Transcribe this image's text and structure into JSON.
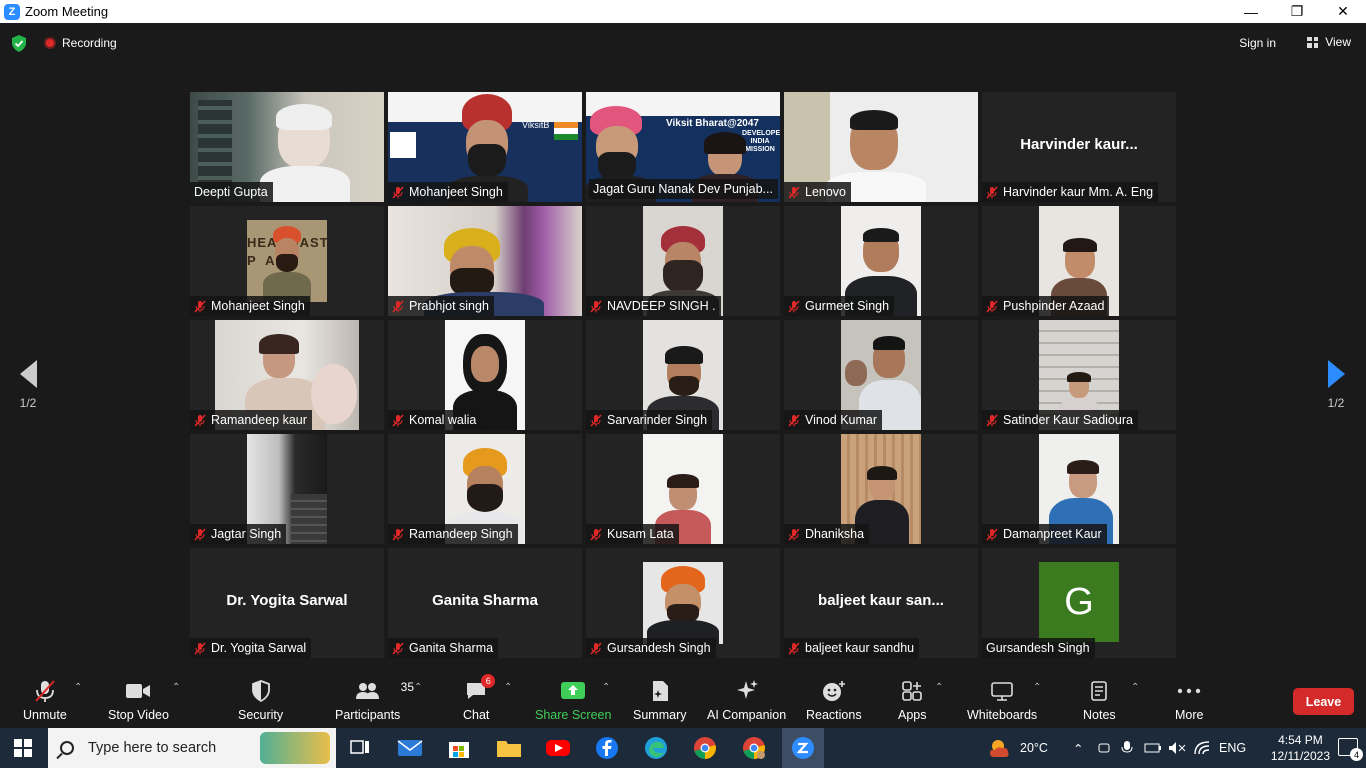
{
  "window": {
    "title": "Zoom Meeting",
    "logo": "Z"
  },
  "topbar": {
    "recording_label": "Recording",
    "signin_label": "Sign in",
    "view_label": "View"
  },
  "pager": {
    "left_label": "1/2",
    "right_label": "1/2"
  },
  "tiles": [
    {
      "name": "Deepti Gupta",
      "muted": false
    },
    {
      "name": "Mohanjeet Singh",
      "muted": true,
      "banner_text": "ViksitB"
    },
    {
      "name": "Jagat Guru Nanak Dev Punjab...",
      "muted": true,
      "active": true,
      "banner_text": "Viksit Bharat@2047",
      "banner_text2": "DEVELOPED INDIA MISSION"
    },
    {
      "name": "Lenovo",
      "muted": true
    },
    {
      "name": "Harvinder kaur Mm. A. Eng",
      "muted": true,
      "display_name": "Harvinder  kaur..."
    },
    {
      "name": "Mohanjeet Singh",
      "muted": true,
      "bg_text": "HEADMASTE P  A"
    },
    {
      "name": "Prabhjot singh",
      "muted": true
    },
    {
      "name": "NAVDEEP SINGH  .",
      "muted": true
    },
    {
      "name": "Gurmeet Singh",
      "muted": true
    },
    {
      "name": "Pushpinder Azaad",
      "muted": true
    },
    {
      "name": "Ramandeep kaur",
      "muted": true
    },
    {
      "name": "Komal walia",
      "muted": true
    },
    {
      "name": "Sarvarinder Singh",
      "muted": true
    },
    {
      "name": "Vinod Kumar",
      "muted": true
    },
    {
      "name": "Satinder Kaur Sadioura",
      "muted": true
    },
    {
      "name": "Jagtar Singh",
      "muted": true
    },
    {
      "name": "Ramandeep Singh",
      "muted": true
    },
    {
      "name": "Kusam Lata",
      "muted": true
    },
    {
      "name": "Dhaniksha",
      "muted": true
    },
    {
      "name": "Damanpreet Kaur",
      "muted": true
    },
    {
      "name": "Dr. Yogita Sarwal",
      "muted": true,
      "display_name": "Dr. Yogita Sarwal"
    },
    {
      "name": "Ganita Sharma",
      "muted": true,
      "display_name": "Ganita Sharma"
    },
    {
      "name": "Gursandesh Singh",
      "muted": true
    },
    {
      "name": "baljeet kaur sandhu",
      "muted": true,
      "display_name": "baljeet  kaur  san..."
    },
    {
      "name": "Gursandesh Singh",
      "muted": false,
      "avatar_letter": "G"
    }
  ],
  "toolbar": {
    "unmute": "Unmute",
    "stop_video": "Stop Video",
    "security": "Security",
    "participants": "Participants",
    "participants_count": "35",
    "chat": "Chat",
    "chat_badge": "6",
    "share_screen": "Share Screen",
    "summary": "Summary",
    "ai_companion": "AI Companion",
    "reactions": "Reactions",
    "apps": "Apps",
    "whiteboards": "Whiteboards",
    "notes": "Notes",
    "more": "More",
    "leave": "Leave"
  },
  "taskbar": {
    "search_placeholder": "Type here to search",
    "temperature": "20°C",
    "language": "ENG",
    "time": "4:54 PM",
    "date": "12/11/2023",
    "notification_count": "4"
  },
  "colors": {
    "accent": "#2d8cff",
    "active_border": "#d6e47a",
    "leave": "#d42a2a",
    "share": "#3fce58",
    "avatar": "#3b7a1e"
  }
}
